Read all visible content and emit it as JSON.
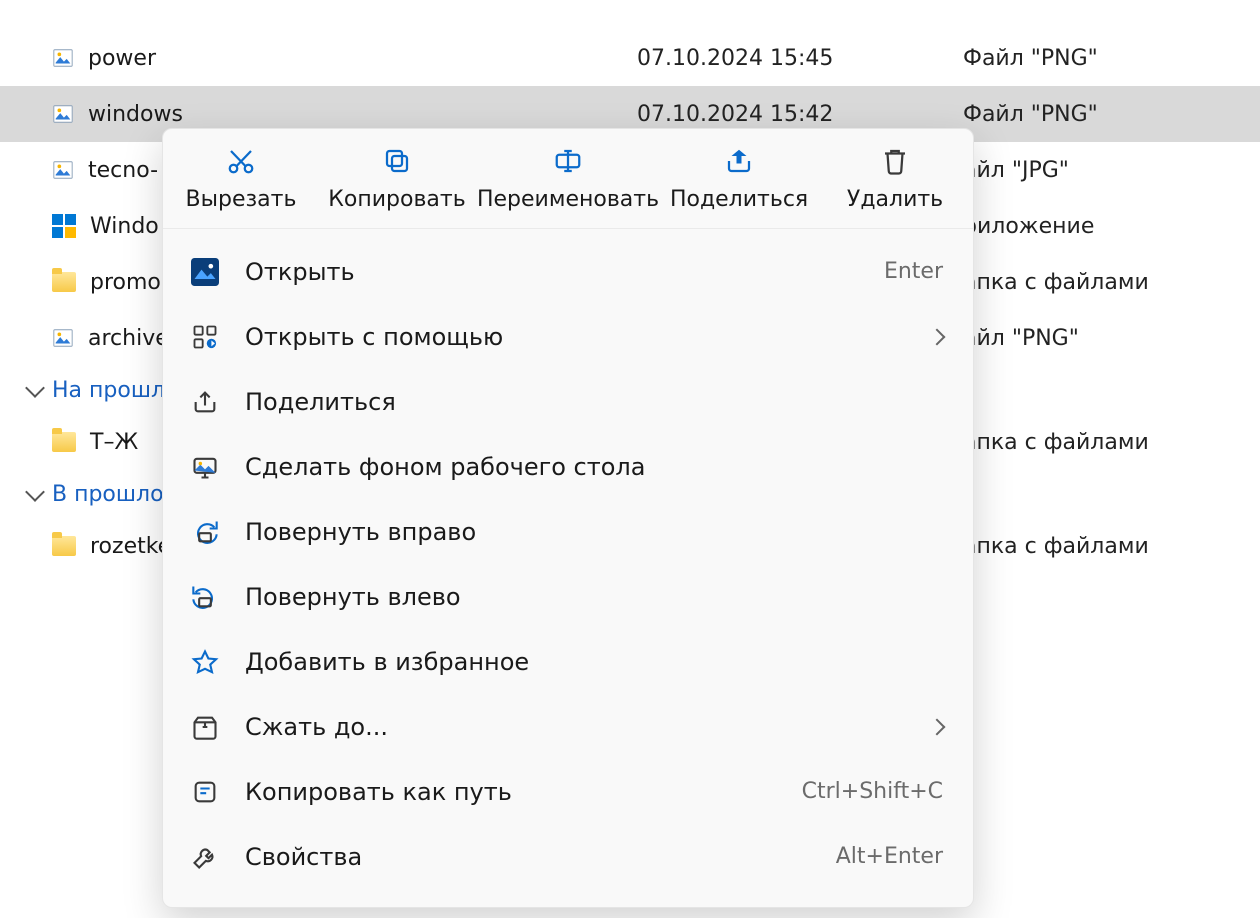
{
  "files": [
    {
      "name": "power",
      "date": "07.10.2024 15:45",
      "type": "Файл \"PNG\"",
      "icon": "image"
    },
    {
      "name": "windows",
      "date": "07.10.2024 15:42",
      "type": "Файл \"PNG\"",
      "icon": "image",
      "selected": true
    },
    {
      "name": "tecno-",
      "date": "",
      "type": "айл \"JPG\"",
      "icon": "image"
    },
    {
      "name": "Windo",
      "date": "",
      "type": "риложение",
      "icon": "winlogo"
    },
    {
      "name": "promo",
      "date": "",
      "type": "апка с файлами",
      "icon": "folder"
    },
    {
      "name": "archive",
      "date": "",
      "type": "айл \"PNG\"",
      "icon": "image"
    }
  ],
  "groups": [
    {
      "label": "На прошл",
      "items": [
        {
          "name": "Т–Ж",
          "type": "апка с файлами",
          "icon": "folder"
        }
      ]
    },
    {
      "label": "В прошло",
      "items": [
        {
          "name": "rozetke",
          "type": "апка с файлами",
          "icon": "folder"
        }
      ]
    }
  ],
  "toolbar": {
    "cut": "Вырезать",
    "copy": "Копировать",
    "rename": "Переименовать",
    "share": "Поделиться",
    "delete": "Удалить"
  },
  "menu": {
    "open": {
      "label": "Открыть",
      "accel": "Enter"
    },
    "open_with": {
      "label": "Открыть с помощью",
      "submenu": true
    },
    "share": {
      "label": "Поделиться"
    },
    "set_bg": {
      "label": "Сделать фоном рабочего стола"
    },
    "rotate_r": {
      "label": "Повернуть вправо"
    },
    "rotate_l": {
      "label": "Повернуть влево"
    },
    "add_fav": {
      "label": "Добавить в избранное"
    },
    "compress": {
      "label": "Сжать до...",
      "submenu": true
    },
    "copy_path": {
      "label": "Копировать как путь",
      "accel": "Ctrl+Shift+C"
    },
    "properties": {
      "label": "Свойства",
      "accel": "Alt+Enter"
    }
  }
}
